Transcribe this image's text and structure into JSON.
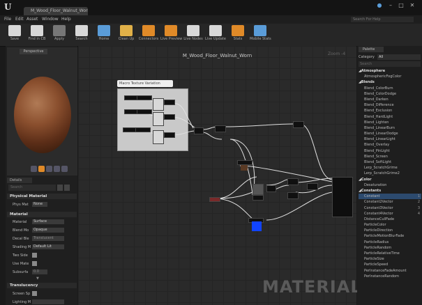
{
  "window": {
    "tab_title": "M_Wood_Floor_Walnut_Worn",
    "logo": "U",
    "controls": [
      "●",
      "–",
      "□",
      "✕"
    ]
  },
  "menu": [
    "File",
    "Edit",
    "Asset",
    "Window",
    "Help"
  ],
  "search_help_placeholder": "Search For Help",
  "toolbar": [
    {
      "label": "Save",
      "icon": "save-icon",
      "color": "#d8d8d8"
    },
    {
      "label": "Find in CB",
      "icon": "find-in-cb-icon",
      "color": "#d8d8d8"
    },
    {
      "label": "Apply",
      "icon": "apply-icon",
      "color": "#777777"
    },
    {
      "label": "Search",
      "icon": "search-icon",
      "color": "#d8d8d8"
    },
    {
      "label": "Home",
      "icon": "home-icon",
      "color": "#5a9cd8"
    },
    {
      "label": "Clean Up",
      "icon": "clean-up-icon",
      "color": "#e0b048"
    },
    {
      "label": "Connectors",
      "icon": "connectors-icon",
      "color": "#e08a28",
      "active": true
    },
    {
      "label": "Live Preview",
      "icon": "live-preview-icon",
      "color": "#e08a28",
      "active": true
    },
    {
      "label": "Live Nodes",
      "icon": "live-nodes-icon",
      "color": "#d8d8d8"
    },
    {
      "label": "Live Update",
      "icon": "live-update-icon",
      "color": "#d8d8d8"
    },
    {
      "label": "Stats",
      "icon": "stats-icon",
      "color": "#e08a28",
      "active": true
    },
    {
      "label": "Mobile Stats",
      "icon": "mobile-stats-icon",
      "color": "#5a9cd8"
    }
  ],
  "viewport": {
    "perspective_label": "Perspective"
  },
  "details": {
    "tab_label": "Details",
    "search_placeholder": "Search",
    "sections": {
      "physical_material": "Physical Material",
      "material": "Material",
      "translucency": "Translucency"
    },
    "phys_material": {
      "label": "Phys Mat",
      "value": "None"
    },
    "properties": [
      {
        "label": "Material",
        "value": "Surface"
      },
      {
        "label": "Blend Mo",
        "value": "Opaque"
      },
      {
        "label": "Decal Ble",
        "value": "Translucent"
      },
      {
        "label": "Shading M",
        "value": "Default Lit"
      }
    ],
    "checkboxes": [
      {
        "label": "Two Side"
      },
      {
        "label": "Use Mate"
      }
    ],
    "subsurface": {
      "label": "Subsurfa",
      "value": "0.0"
    },
    "translucency_rows": [
      {
        "label": "Screen Sp"
      },
      {
        "label": "Lighting M"
      }
    ]
  },
  "graph": {
    "title": "M_Wood_Floor_Walnut_Worn",
    "zoom": "Zoom -4",
    "watermark": "MATERIAL",
    "comment_label": "Macro Texture Variation"
  },
  "palette": {
    "tab_label": "Palette",
    "category_label": "Category",
    "category_value": "All",
    "search_placeholder": "Search",
    "items": [
      {
        "text": "◢Atmosphere",
        "cat": true
      },
      {
        "text": "AtmosphericFogColor"
      },
      {
        "text": "◢Blends",
        "cat": true
      },
      {
        "text": "Blend_ColorBurn"
      },
      {
        "text": "Blend_ColorDodge"
      },
      {
        "text": "Blend_Darken"
      },
      {
        "text": "Blend_Difference"
      },
      {
        "text": "Blend_Exclusion"
      },
      {
        "text": "Blend_HardLight"
      },
      {
        "text": "Blend_Lighten"
      },
      {
        "text": "Blend_LinearBurn"
      },
      {
        "text": "Blend_LinearDodge"
      },
      {
        "text": "Blend_LinearLight"
      },
      {
        "text": "Blend_Overlay"
      },
      {
        "text": "Blend_PinLight"
      },
      {
        "text": "Blend_Screen"
      },
      {
        "text": "Blend_SoftLight"
      },
      {
        "text": "Lerp_ScratchGrime"
      },
      {
        "text": "Lerp_ScratchGrime2"
      },
      {
        "text": "◢Color",
        "cat": true
      },
      {
        "text": "Desaturation"
      },
      {
        "text": "◢Constants",
        "cat": true
      },
      {
        "text": "Constant",
        "key": "1",
        "sel": true
      },
      {
        "text": "Constant2Vector",
        "key": "2"
      },
      {
        "text": "Constant3Vector",
        "key": "3"
      },
      {
        "text": "Constant4Vector",
        "key": "4"
      },
      {
        "text": "DistanceCullFade"
      },
      {
        "text": "ParticleColor"
      },
      {
        "text": "ParticleDirection"
      },
      {
        "text": "ParticleMotionBlurFade"
      },
      {
        "text": "ParticleRadius"
      },
      {
        "text": "ParticleRandom"
      },
      {
        "text": "ParticleRelativeTime"
      },
      {
        "text": "ParticleSize"
      },
      {
        "text": "ParticleSpeed"
      },
      {
        "text": "PerInstanceFadeAmount"
      },
      {
        "text": "PerInstanceRandom"
      }
    ]
  }
}
